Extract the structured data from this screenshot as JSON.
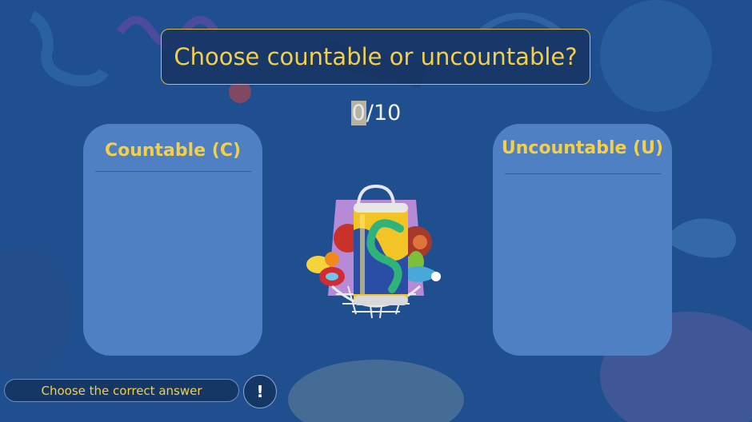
{
  "question": {
    "text": "Choose countable or uncountable?"
  },
  "progress": {
    "current": "0",
    "total_label": "/10"
  },
  "categories": {
    "countable": {
      "label": "Countable (C)"
    },
    "uncountable": {
      "label": "Uncountable (U)"
    }
  },
  "item": {
    "icon": "canned-drink-and-groceries-icon"
  },
  "hint": {
    "text": "Choose the correct answer",
    "button": "!"
  },
  "colors": {
    "background": "#1f4f8f",
    "accent_yellow": "#f3cf4a",
    "panel": "#4f80c4"
  }
}
